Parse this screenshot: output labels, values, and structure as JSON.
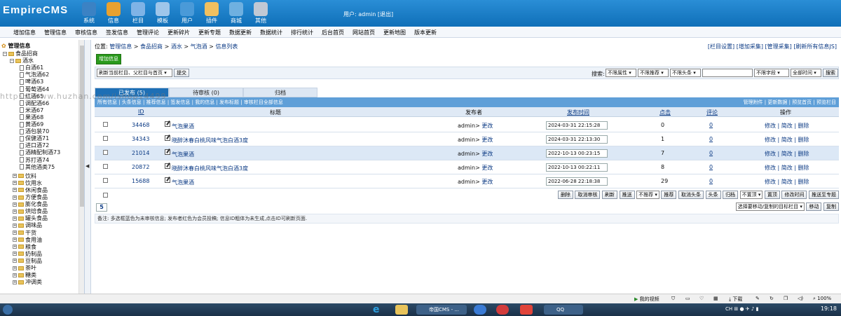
{
  "app": {
    "logo": "EmpireCMS",
    "user_label": "用户: admin",
    "logout": "[退出]"
  },
  "top_icons": [
    {
      "label": "系统",
      "icon": "globe-icon",
      "color": "#3b82c4"
    },
    {
      "label": "信息",
      "icon": "edit-icon",
      "color": "#e9a12f"
    },
    {
      "label": "栏目",
      "icon": "folder-icon",
      "color": "#7fb3e6"
    },
    {
      "label": "模板",
      "icon": "template-icon",
      "color": "#9fc6ea"
    },
    {
      "label": "用户",
      "icon": "user-icon",
      "color": "#4a9ad8"
    },
    {
      "label": "插件",
      "icon": "tools-icon",
      "color": "#f0c060"
    },
    {
      "label": "商城",
      "icon": "shop-icon",
      "color": "#6fb0e0"
    },
    {
      "label": "其他",
      "icon": "gear-icon",
      "color": "#c0c8d4"
    }
  ],
  "menu": [
    "增加信息",
    "管理信息",
    "审核信息",
    "签发信息",
    "管理评论",
    "更新碎片",
    "更新专题",
    "数据更新",
    "数据统计",
    "排行统计",
    "后台首页",
    "网站首页",
    "更新地图",
    "版本更新"
  ],
  "tree": {
    "root": "管理信息",
    "top": "食品招商",
    "open": "酒水",
    "children": [
      "白酒61",
      "气泡酒62",
      "啤酒63",
      "葡萄酒64",
      "红酒65",
      "调配酒66",
      "米酒67",
      "果酒68",
      "黄酒69",
      "酒包装70",
      "保健酒71",
      "进口酒72",
      "酒精配制酒73",
      "苏打酒74",
      "其他酒类75"
    ],
    "folders": [
      "饮料",
      "饮用水",
      "休闲食品",
      "方便食品",
      "膨化食品",
      "烘焙食品",
      "罐头食品",
      "调味品",
      "干货",
      "食用油",
      "粮食",
      "奶制品",
      "豆制品",
      "茶叶",
      "糖类",
      "冲调类"
    ]
  },
  "breadcrumb": {
    "prefix": "位置:",
    "items": [
      "管理信息",
      "食品招商",
      "酒水",
      "气泡酒",
      "信息列表"
    ]
  },
  "right_links": [
    "[栏目设置]",
    "[增加采集]",
    "[管理采集]",
    "[刷新所有信息JS]"
  ],
  "add_button": "增加信息",
  "filter": {
    "refresh_select": "刷新当前栏目、父栏目与首页",
    "submit": "提交",
    "search_label": "搜索:",
    "selects": [
      "不限属性",
      "不限推荐",
      "不限头条"
    ],
    "field_select": "不限字段",
    "time_select": "全部时间",
    "search_button": "搜索"
  },
  "tabs": [
    "已发布 (5)",
    "待审核 (0)",
    "归档"
  ],
  "table_bar": {
    "left": "所有信息 | 头条信息 | 推荐信息 | 签发信息 | 我的信息 | 发布标题 | 审核栏目全部信息",
    "right": "管理附件 | 更新数据 | 预览首页 | 预览栏目"
  },
  "columns": {
    "id": "ID",
    "title": "标题",
    "publisher": "发布者",
    "time": "发布时间",
    "clicks": "点击",
    "comments": "评论",
    "ops": "操作"
  },
  "rows": [
    {
      "id": "34468",
      "title": "气泡果酒",
      "publisher": "admin",
      "edit": "更改",
      "time": "2024-03-31 22:15:28",
      "clicks": "0",
      "comments": "0",
      "ops": "修改 | 简改 | 删除"
    },
    {
      "id": "34343",
      "title": "晓醉沐春白桃风味气泡白酒3度",
      "publisher": "admin",
      "edit": "更改",
      "time": "2024-03-31 22:13:30",
      "clicks": "1",
      "comments": "0",
      "ops": "修改 | 简改 | 删除"
    },
    {
      "id": "21014",
      "title": "气泡果酒",
      "publisher": "admin",
      "edit": "更改",
      "time": "2022-10-13 00:23:15",
      "clicks": "7",
      "comments": "0",
      "ops": "修改 | 简改 | 删除"
    },
    {
      "id": "20872",
      "title": "晓醉沐春白桃风味气泡白酒3度",
      "publisher": "admin",
      "edit": "更改",
      "time": "2022-10-13 00:22:11",
      "clicks": "8",
      "comments": "0",
      "ops": "修改 | 简改 | 删除"
    },
    {
      "id": "15688",
      "title": "气泡果酒",
      "publisher": "admin",
      "edit": "更改",
      "time": "2022-06-28 22:18:38",
      "clicks": "29",
      "comments": "0",
      "ops": "修改 | 简改 | 删除"
    }
  ],
  "actions": [
    "删除",
    "取消审核",
    "刷新",
    "推送"
  ],
  "actions2": [
    "推荐",
    "取消头条",
    "头条",
    "归档"
  ],
  "actions3": [
    "置顶",
    "修改时间",
    "推送至专题"
  ],
  "select_recommend": "不推荐",
  "select_top": "不置顶",
  "move_select": "选择要移动/复制的目标栏目",
  "move_btn": "移动",
  "copy_btn": "复制",
  "page": "5",
  "note": "备注: 多选框蓝色为未审核信息; 发布者红色为会员投稿; 信息ID粗体为未生成,点击ID可刷新页面.",
  "watermark": "https://www.huzhan.com/ishop14499",
  "statusbar": {
    "video": "我的视频",
    "download": "下载",
    "zoom": "100%"
  },
  "taskbar": {
    "items": [
      "帝国CMS - ...",
      "QQ"
    ],
    "time": "19:18"
  }
}
